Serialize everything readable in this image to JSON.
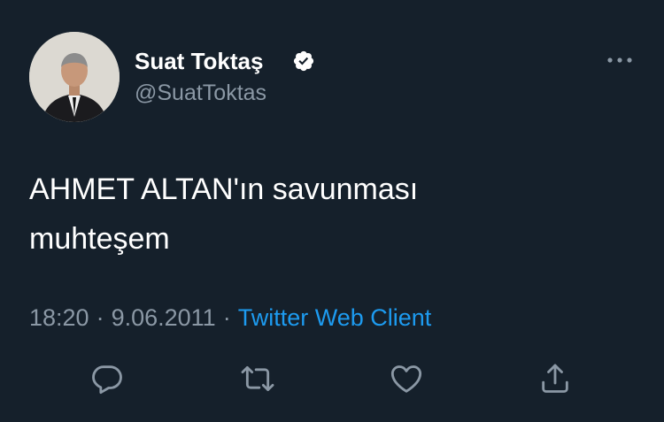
{
  "author": {
    "display_name": "Suat Toktaş",
    "handle": "@SuatToktas",
    "verified": true
  },
  "tweet": {
    "lines": [
      "AHMET ALTAN'ın savunması",
      "muhteşem"
    ]
  },
  "meta": {
    "time": "18:20",
    "date": "9.06.2011",
    "separator": "·",
    "client": "Twitter Web Client"
  },
  "colors": {
    "background": "#15202b",
    "text_primary": "#ffffff",
    "text_secondary": "#8b98a5",
    "accent": "#1d9bf0"
  },
  "icons": {
    "more": "more-horizontal-icon",
    "verified": "verified-badge-icon",
    "actions": [
      "reply-icon",
      "retweet-icon",
      "like-icon",
      "share-icon"
    ]
  }
}
